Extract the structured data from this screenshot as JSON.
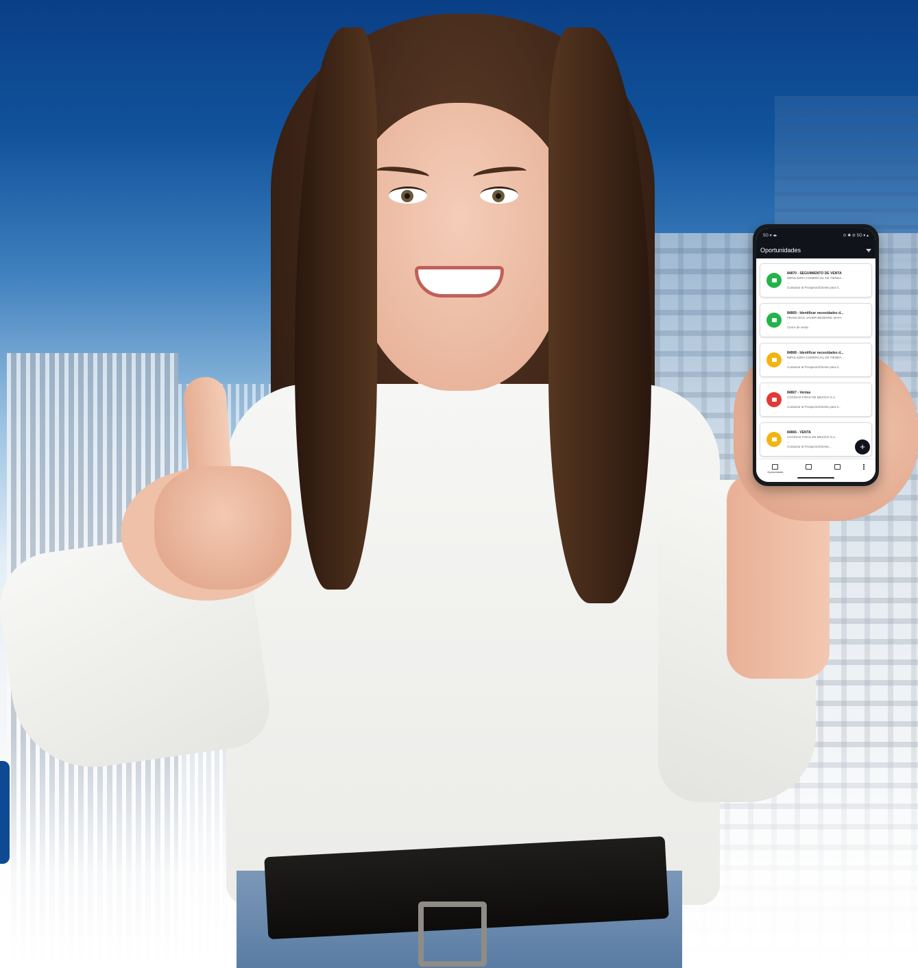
{
  "phone": {
    "status_left": "5G ▾ ◂▸",
    "status_right": "⊙ ✱ ⊘ 5G ▾ ▴",
    "app_title": "Oportunidades",
    "filter_icon": "filter-icon",
    "fab_label": "+",
    "cards": [
      {
        "title": "84870 - SEGUIMIENTO DE VENTA",
        "subtitle": "IMPULSORA COMERCIAL DE TIENDA...",
        "meta": "—",
        "line": "Contactar al Prospecto/Cliente para it...",
        "status_color": "#22b34a"
      },
      {
        "title": "84869 - Identificar necesidades d...",
        "subtitle": "FRANCISCO JAVIER BESERRIL MATA",
        "meta": "—",
        "line": "Cierre de venta",
        "status_color": "#22b34a"
      },
      {
        "title": "84868 - Identificar necesidades d...",
        "subtitle": "IMPULSORA COMERCIAL DE TIENDA...",
        "meta": "—",
        "line": "Contactar al Prospecto/Cliente para it...",
        "status_color": "#f2b40f"
      },
      {
        "title": "84867 - Ventas",
        "subtitle": "COCINAS FINAS DE MEXICO S.A.",
        "meta": "—",
        "line": "Contactar al Prospecto/Cliente para it...",
        "status_color": "#e53935"
      },
      {
        "title": "84866 - VENTA",
        "subtitle": "COCINAS FINAS DE MEXICO S.A.",
        "meta": "—",
        "line": "Contactar al Prospecto/Cliente...",
        "status_color": "#f2b40f"
      }
    ],
    "nav": {
      "item1_label": "Oportunidades",
      "item1_icon": "chat-icon",
      "item2_icon": "calendar-icon",
      "item3_icon": "contacts-icon",
      "item4_icon": "more-vert-icon"
    }
  }
}
